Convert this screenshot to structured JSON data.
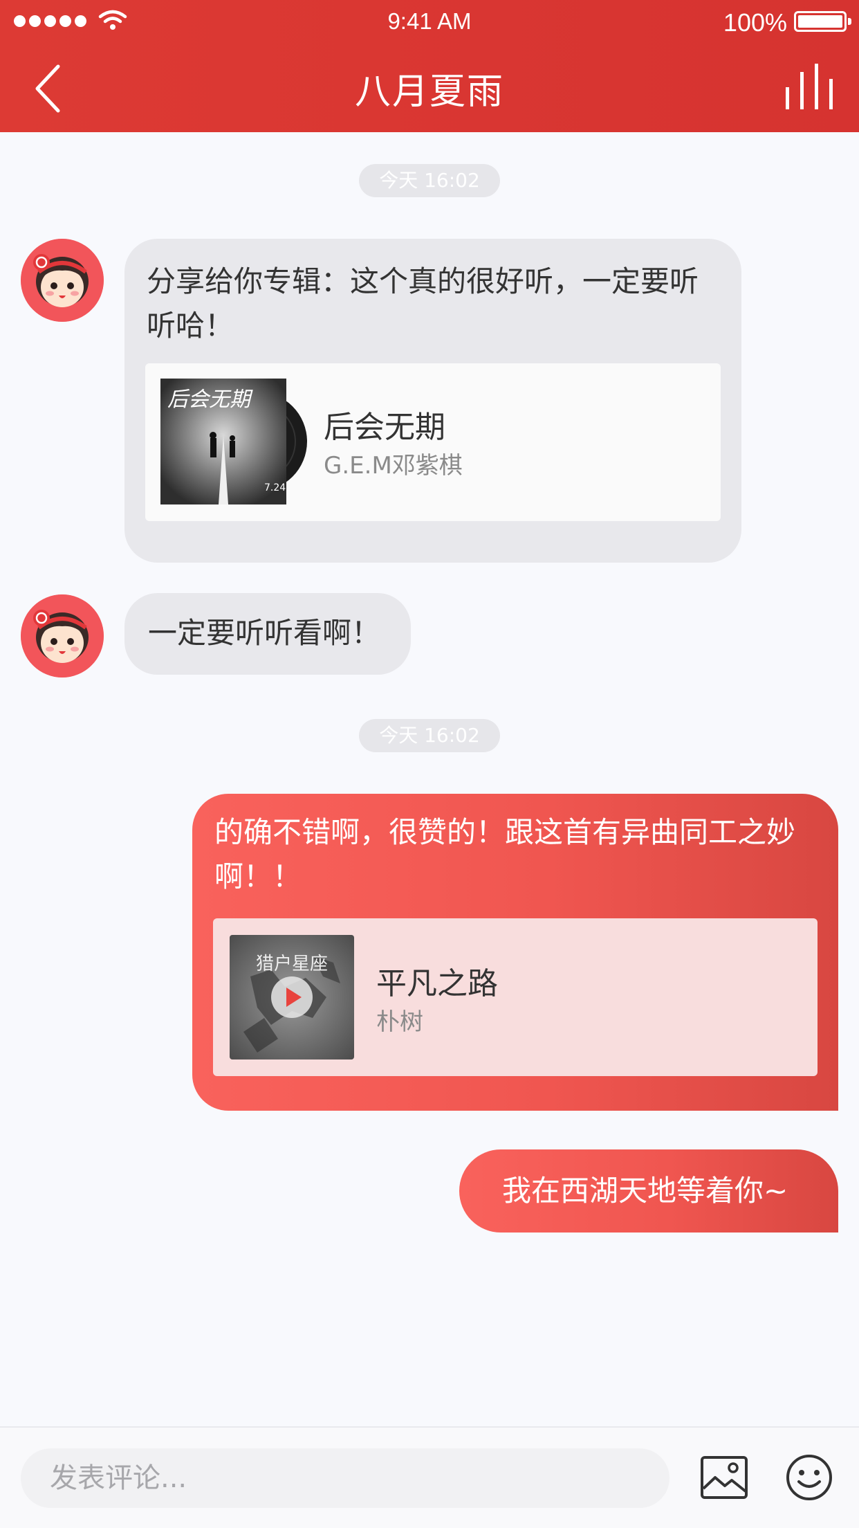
{
  "status_bar": {
    "time": "9:41 AM",
    "battery": "100%",
    "signal_icon": "signal-dots-icon",
    "wifi_icon": "wifi-icon",
    "battery_icon": "battery-icon"
  },
  "nav": {
    "title": "八月夏雨",
    "back_icon": "chevron-left-icon",
    "equalizer_icon": "equalizer-icon"
  },
  "colors": {
    "brand_red": "#d9342f",
    "bubble_received": "#e8e8ec",
    "bubble_sent_start": "#f9625c",
    "bubble_sent_end": "#d84741"
  },
  "messages": [
    {
      "type": "timestamp",
      "text": "今天 16:02"
    },
    {
      "type": "received",
      "text": "分享给你专辑：这个真的很好听，一定要听听哈！",
      "card": {
        "title": "后会无期",
        "artist": "G.E.M邓紫棋",
        "cover_text": "后会无期",
        "cover_date": "7.24"
      }
    },
    {
      "type": "received",
      "text": "一定要听听看啊！"
    },
    {
      "type": "timestamp",
      "text": "今天 16:02"
    },
    {
      "type": "sent",
      "text": "的确不错啊，很赞的！跟这首有异曲同工之妙啊！！",
      "card": {
        "title": "平凡之路",
        "artist": "朴树",
        "cover_text": "猎户星座"
      }
    },
    {
      "type": "sent",
      "text": "我在西湖天地等着你~"
    }
  ],
  "input": {
    "placeholder": "发表评论...",
    "value": "",
    "image_icon": "image-icon",
    "emoji_icon": "emoji-icon"
  }
}
